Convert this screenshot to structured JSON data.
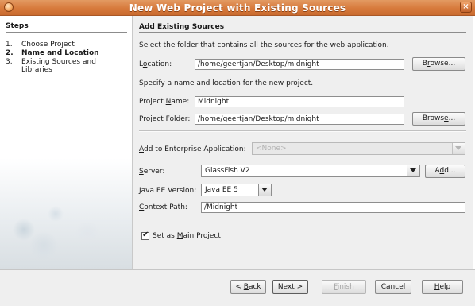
{
  "window": {
    "title": "New Web Project with Existing Sources",
    "close_label": "×"
  },
  "steps": {
    "heading": "Steps",
    "items": [
      {
        "num": "1.",
        "label": "Choose Project"
      },
      {
        "num": "2.",
        "label": "Name and Location"
      },
      {
        "num": "3.",
        "label": "Existing Sources and Libraries"
      }
    ]
  },
  "main": {
    "section_title": "Add Existing Sources",
    "instruction": "Select the folder that contains all the sources for the web application.",
    "location": {
      "label_prefix": "L",
      "label_u": "o",
      "label_rest": "cation:",
      "value": "/home/geertjan/Desktop/midnight"
    },
    "browse1": {
      "pre": "B",
      "u": "r",
      "post": "owse..."
    },
    "name_instruction": "Specify a name and location for the new project.",
    "project_name": {
      "label_pre": "Project ",
      "label_u": "N",
      "label_post": "ame:",
      "value": "Midnight"
    },
    "project_folder": {
      "label_pre": "Project ",
      "label_u": "F",
      "label_post": "older:",
      "value": "/home/geertjan/Desktop/midnight"
    },
    "browse2": {
      "pre": "Brows",
      "u": "e",
      "post": "..."
    },
    "enterprise": {
      "label_u": "A",
      "label_post": "dd to Enterprise Application:",
      "value": "<None>"
    },
    "server": {
      "label_u": "S",
      "label_post": "erver:",
      "value": "GlassFish V2"
    },
    "add_button": {
      "pre": "A",
      "u": "d",
      "post": "d..."
    },
    "javaee": {
      "label_u": "J",
      "label_post": "ava EE Version:",
      "value": "Java EE 5"
    },
    "context": {
      "label_u": "C",
      "label_post": "ontext Path:",
      "value": "/Midnight"
    },
    "main_project": {
      "label_pre": "Set as ",
      "label_u": "M",
      "label_post": "ain Project",
      "checked": true
    }
  },
  "footer": {
    "back": {
      "pre": "< ",
      "u": "B",
      "post": "ack"
    },
    "next": "Next >",
    "finish": {
      "u": "F",
      "post": "inish"
    },
    "cancel": "Cancel",
    "help": {
      "u": "H",
      "post": "elp"
    }
  }
}
